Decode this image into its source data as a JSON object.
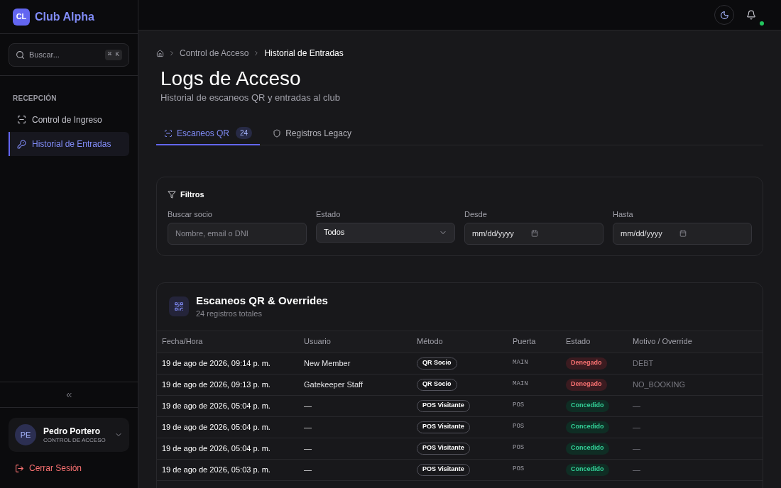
{
  "sidebar": {
    "logo": {
      "initials": "CL",
      "name": "Club Alpha"
    },
    "search": {
      "placeholder": "Buscar...",
      "shortcut": "⌘ K"
    },
    "section": "RECEPCIÓN",
    "items": [
      {
        "label": "Control de Ingreso",
        "selected": false
      },
      {
        "label": "Historial de Entradas",
        "selected": true
      }
    ],
    "user": {
      "initials": "PE",
      "name": "Pedro Portero",
      "role": "CONTROL DE ACCESO"
    },
    "logout": "Cerrar Sesión"
  },
  "topbar": {
    "notification_dot": true
  },
  "breadcrumb": [
    "Control de Acceso",
    "Historial de Entradas"
  ],
  "page": {
    "title": "Logs de Acceso",
    "subtitle": "Historial de escaneos QR y entradas al club"
  },
  "tabs": [
    {
      "label": "Escaneos QR",
      "count": "24",
      "selected": true
    },
    {
      "label": "Registros Legacy",
      "selected": false
    }
  ],
  "filters": {
    "title": "Filtros",
    "fields": [
      {
        "kind": "text",
        "label": "Buscar socio",
        "placeholder": "Nombre, email o DNI"
      },
      {
        "kind": "select",
        "label": "Estado",
        "value": "Todos"
      },
      {
        "kind": "date",
        "label": "Desde",
        "placeholder": "mm/dd/yyyy"
      },
      {
        "kind": "date",
        "label": "Hasta",
        "placeholder": "mm/dd/yyyy"
      }
    ]
  },
  "table": {
    "title": "Escaneos QR & Overrides",
    "subtitle": "24 registros totales",
    "columns": [
      "Fecha/Hora",
      "Usuario",
      "Método",
      "Puerta",
      "Estado",
      "Motivo / Override"
    ],
    "rows": [
      {
        "datetime": "19 de ago de 2026, 09:14 p. m.",
        "user": "New Member",
        "method": "QR Socio",
        "door": "MAIN",
        "status": {
          "text": "Denegado",
          "kind": "denied"
        },
        "reason": "DEBT"
      },
      {
        "datetime": "19 de ago de 2026, 09:13 p. m.",
        "user": "Gatekeeper Staff",
        "method": "QR Socio",
        "door": "MAIN",
        "status": {
          "text": "Denegado",
          "kind": "denied"
        },
        "reason": "NO_BOOKING"
      },
      {
        "datetime": "19 de ago de 2026, 05:04 p. m.",
        "user": "—",
        "method": "POS Visitante",
        "door": "POS",
        "status": {
          "text": "Concedido",
          "kind": "granted"
        },
        "reason": "—"
      },
      {
        "datetime": "19 de ago de 2026, 05:04 p. m.",
        "user": "—",
        "method": "POS Visitante",
        "door": "POS",
        "status": {
          "text": "Concedido",
          "kind": "granted"
        },
        "reason": "—"
      },
      {
        "datetime": "19 de ago de 2026, 05:04 p. m.",
        "user": "—",
        "method": "POS Visitante",
        "door": "POS",
        "status": {
          "text": "Concedido",
          "kind": "granted"
        },
        "reason": "—"
      },
      {
        "datetime": "19 de ago de 2026, 05:03 p. m.",
        "user": "—",
        "method": "POS Visitante",
        "door": "POS",
        "status": {
          "text": "Concedido",
          "kind": "granted"
        },
        "reason": "—"
      }
    ]
  }
}
